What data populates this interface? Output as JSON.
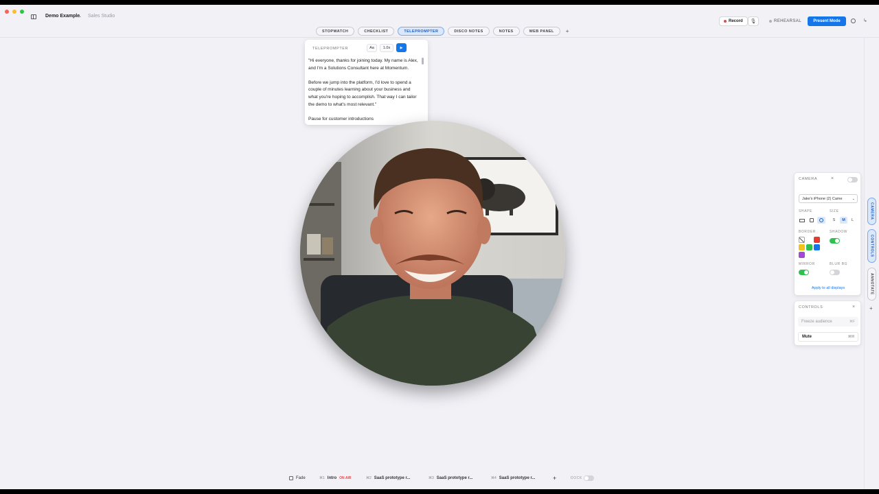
{
  "header": {
    "doc_title": "Demo Example",
    "doc_sub": "Sales Studio",
    "record_label": "Record",
    "rehearsal_label": "REHEARSAL",
    "present_label": "Present Mode",
    "accent_color": "#1476e8"
  },
  "tabs": [
    {
      "label": "STOPWATCH",
      "active": false
    },
    {
      "label": "CHECKLIST",
      "active": false
    },
    {
      "label": "TELEPROMPTER",
      "active": true
    },
    {
      "label": "DISCO NOTES",
      "active": false
    },
    {
      "label": "NOTES",
      "active": false
    },
    {
      "label": "WEB PANEL",
      "active": false
    }
  ],
  "tab_add": "+",
  "teleprompter": {
    "title": "TELEPROMPTER",
    "font_btn": "Aa",
    "speed": "1.0x",
    "play_icon": "play-icon",
    "script": "\"Hi everyone, thanks for joining today. My name is Alex, and I'm a Solutions Consultant here at Momentum.\n\nBefore we jump into the platform, I'd love to spend a couple of minutes learning about your business and what you're hoping to accomplish. That way I can tailor the demo to what's most relevant.\"\n\nPause for customer introductions"
  },
  "camera_panel": {
    "title": "CAMERA",
    "enabled": false,
    "device": "Jake's iPhone (2) Came",
    "shape_label": "SHAPE",
    "size_label": "SIZE",
    "sizes": [
      "S",
      "M",
      "L"
    ],
    "selected_size": "M",
    "selected_shape": "circle",
    "border_label": "BORDER",
    "shadow_label": "SHADOW",
    "shadow_on": true,
    "border_colors": [
      "none",
      "#e53b30",
      "#f2c31a",
      "#30c04f",
      "#1476e8",
      "#a24ad6"
    ],
    "mirror_label": "MIRROR",
    "mirror_on": true,
    "blur_label": "BLUR BG",
    "blur_on": false,
    "apply_label": "Apply to all displays"
  },
  "controls_panel": {
    "title": "CONTROLS",
    "freeze_label": "Freeze audience",
    "freeze_key": "⌘F",
    "mute_label": "Mute",
    "mute_key": "⌘M"
  },
  "side_tabs": [
    {
      "label": "CAMERA",
      "active": true
    },
    {
      "label": "CONTROLS",
      "active": true
    },
    {
      "label": "ANNOTATE",
      "active": false
    }
  ],
  "bottom": {
    "fade_label": "Fade",
    "scenes": [
      {
        "num": "⌘1",
        "name": "Intro",
        "badge": "ON AIR"
      },
      {
        "num": "⌘2",
        "name": "SaaS prototype r..."
      },
      {
        "num": "⌘3",
        "name": "SaaS prototype r..."
      },
      {
        "num": "⌘4",
        "name": "SaaS prototype r..."
      }
    ],
    "add": "+",
    "dock_label": "DOCK",
    "dock_on": false
  }
}
